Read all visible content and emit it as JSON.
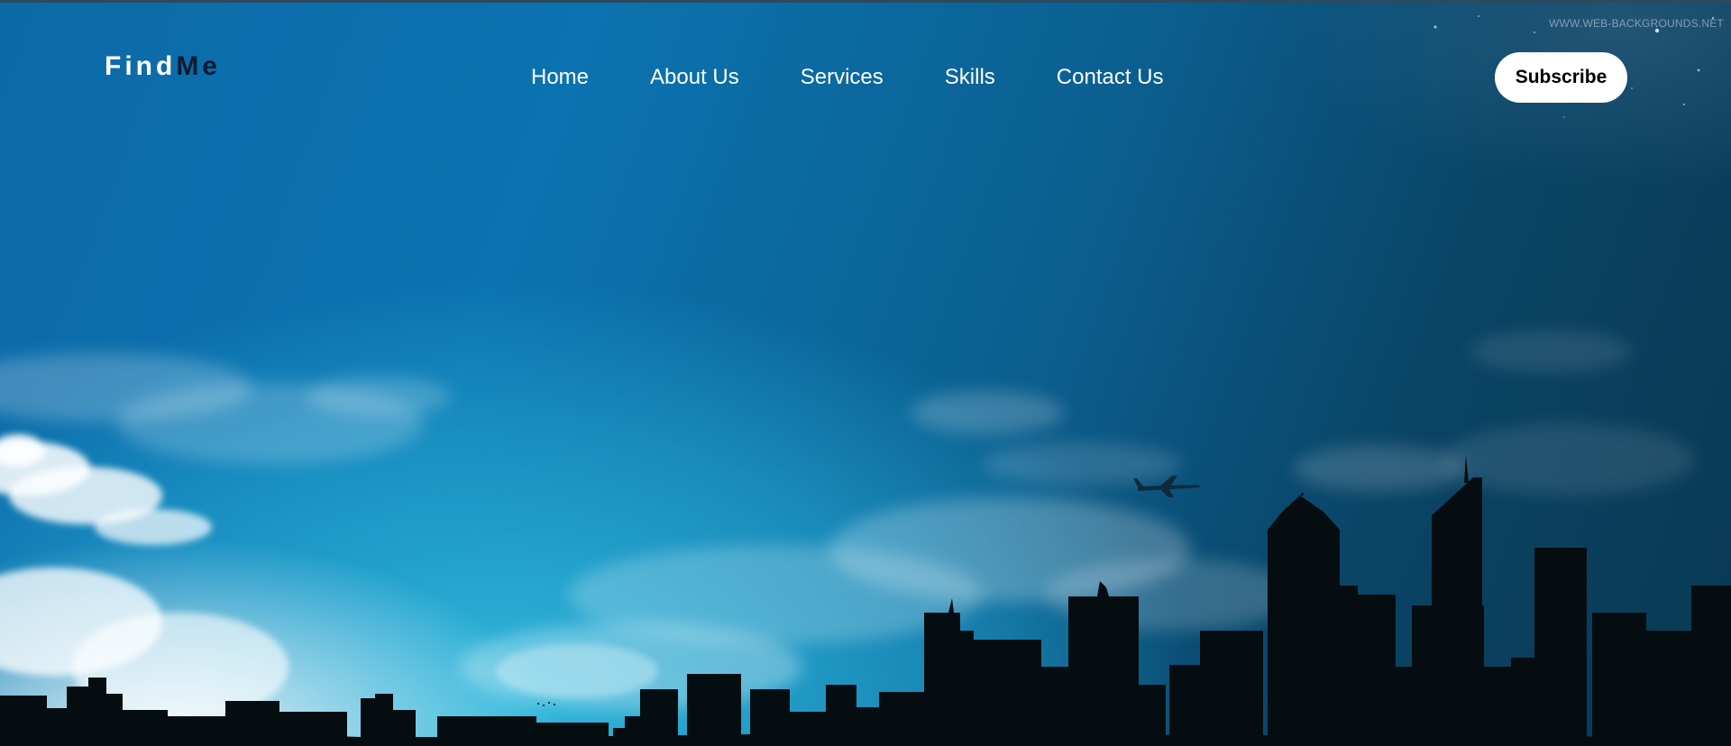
{
  "logo": {
    "part1": "Find",
    "part2": "Me"
  },
  "nav": {
    "items": [
      {
        "label": "Home"
      },
      {
        "label": "About Us"
      },
      {
        "label": "Services"
      },
      {
        "label": "Skills"
      },
      {
        "label": "Contact Us"
      }
    ]
  },
  "subscribe": {
    "label": "Subscribe"
  },
  "background": {
    "watermark": "WWW.WEB-BACKGROUNDS.NET",
    "scene": [
      "sky",
      "clouds",
      "airplane",
      "city-skyline-silhouette"
    ],
    "colors": {
      "sky_top": "#0b73b0",
      "sky_glow": "#2fb8dc",
      "silhouette": "#060d11"
    }
  }
}
